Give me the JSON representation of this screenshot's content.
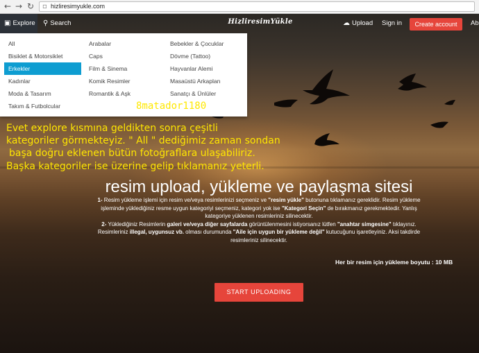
{
  "browser": {
    "url": "hizliresimyukle.com",
    "back_icon": "back-arrow-icon",
    "forward_icon": "forward-arrow-icon",
    "refresh_icon": "refresh-icon"
  },
  "header": {
    "explore": "Explore",
    "search": "Search",
    "logo": "HizliresimYükle",
    "upload": "Upload",
    "signin": "Sign in",
    "create_account": "Create account",
    "about": "Abo"
  },
  "dropdown": {
    "col1": [
      "All",
      "Bisiklet & Motorsiklet",
      "Erkekler",
      "Kadınlar",
      "Moda & Tasarım",
      "Takım & Futbolcular"
    ],
    "col2": [
      "Arabalar",
      "Caps",
      "Film & Sinema",
      "Komik Resimler",
      "Romantik & Aşk"
    ],
    "col3": [
      "Bebekler & Çocuklar",
      "Dövme (Tattoo)",
      "Hayvanlar Alemi",
      "Masaüstü Arkaplan",
      "Sanatçı & Ünlüler"
    ],
    "active": "Erkekler"
  },
  "annotation": {
    "tag": "8matador1180",
    "lines": [
      "Evet explore kısmına geldikten sonra çeşitli",
      "kategoriler görmekteyiz. \" All \" dediğimiz zaman sondan",
      "başa doğru eklenen bütün fotoğraflara ulaşabiliriz.",
      "Başka kategoriler ise üzerine gelip tıklamanız yeterli."
    ]
  },
  "main": {
    "title": "resim upload, yükleme ve paylaşma sitesi",
    "p1": {
      "num": "1-",
      "a": " Resim yükleme işlemi için resim ve/veya resimlerinizi seçmeniz ve ",
      "b1": "\"resim yükle\"",
      "c": " butonuna tıklamanız gereklidir. Resim yükleme işleminde yüklediğiniz resme uygun kategoriyi seçmeniz, kategori yok ise ",
      "b2": "\"Kategori Seçin\"",
      "d": " de bırakmanız gerekmektedir. Yanlış kategoriye yüklenen resimleriniz silinecektir."
    },
    "p2": {
      "num": "2-",
      "a": " Yüklediğiniz Resimlerin ",
      "b1": "galeri ve/veya diğer sayfalarda",
      "c": " görüntülenmesini istiyorsanız lütfen ",
      "b2": "\"anahtar simgesine\"",
      "d": " tıklayınız. Resimleriniz ",
      "b3": "illegal, uygunsuz vb.",
      "e": " olması durumunda ",
      "b4": "\"Aile için uygun bir yükleme değil\"",
      "f": " kutucuğunu işaretleyiniz. Aksi takdirde resimleriniz silinecektir."
    },
    "size_note": "Her bir resim için yükleme boyutu : 10 MB",
    "start_button": "START UPLOADING"
  },
  "colors": {
    "accent": "#e6453b",
    "active_item": "#0e9dd1",
    "annotation": "#ffe600"
  }
}
